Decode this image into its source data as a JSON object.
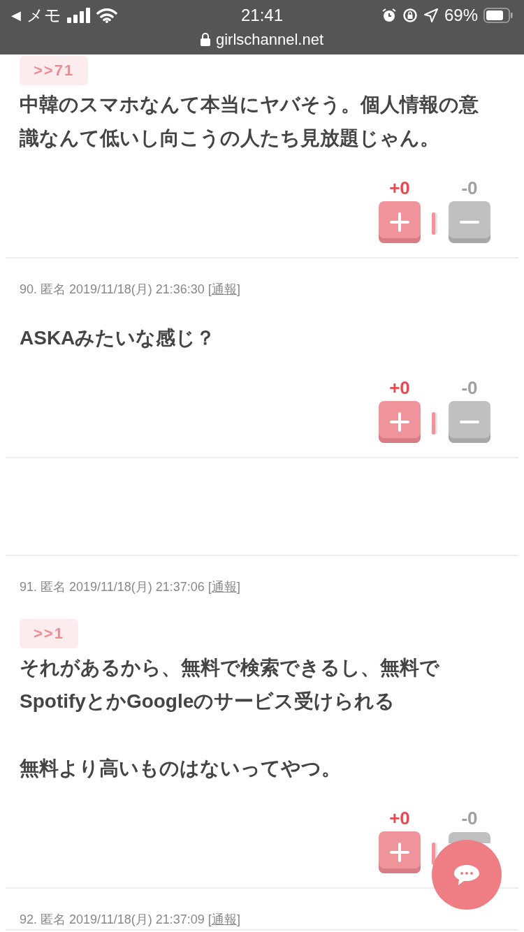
{
  "status_bar": {
    "back": "◀",
    "carrier": "メモ",
    "time": "21:41",
    "battery": "69%",
    "url": "girlschannel.net"
  },
  "comments": [
    {
      "kind": "comment",
      "anchor": ">>71",
      "paragraphs": [
        [
          "中韓のスマホなんて本当にヤバそう。個人情報の意",
          "識なんて低いし向こうの人たち見放題じゃん。"
        ]
      ],
      "plus": "+0",
      "minus": "-0"
    },
    {
      "kind": "comment",
      "meta": {
        "text": "90. 匿名 2019/11/18(月) 21:36:30",
        "open": "[",
        "link": "通報",
        "close": "]"
      },
      "paragraphs": [
        [
          "ASKAみたいな感じ？"
        ]
      ],
      "plus": "+0",
      "minus": "-0"
    },
    {
      "kind": "ad_space"
    },
    {
      "kind": "comment",
      "meta": {
        "text": "91. 匿名 2019/11/18(月) 21:37:06",
        "open": "[",
        "link": "通報",
        "close": "]"
      },
      "anchor": ">>1",
      "paragraphs": [
        [
          "それがあるから、無料で検索できるし、無料で",
          "SpotifyとかGoogleのサービス受けられる"
        ],
        [
          "無料より高いものはないってやつ。"
        ]
      ],
      "plus": "+0",
      "minus": "-0"
    },
    {
      "kind": "comment",
      "meta": {
        "text": "92. 匿名 2019/11/18(月) 21:37:09",
        "open": "[",
        "link": "通報",
        "close": "]"
      }
    }
  ]
}
